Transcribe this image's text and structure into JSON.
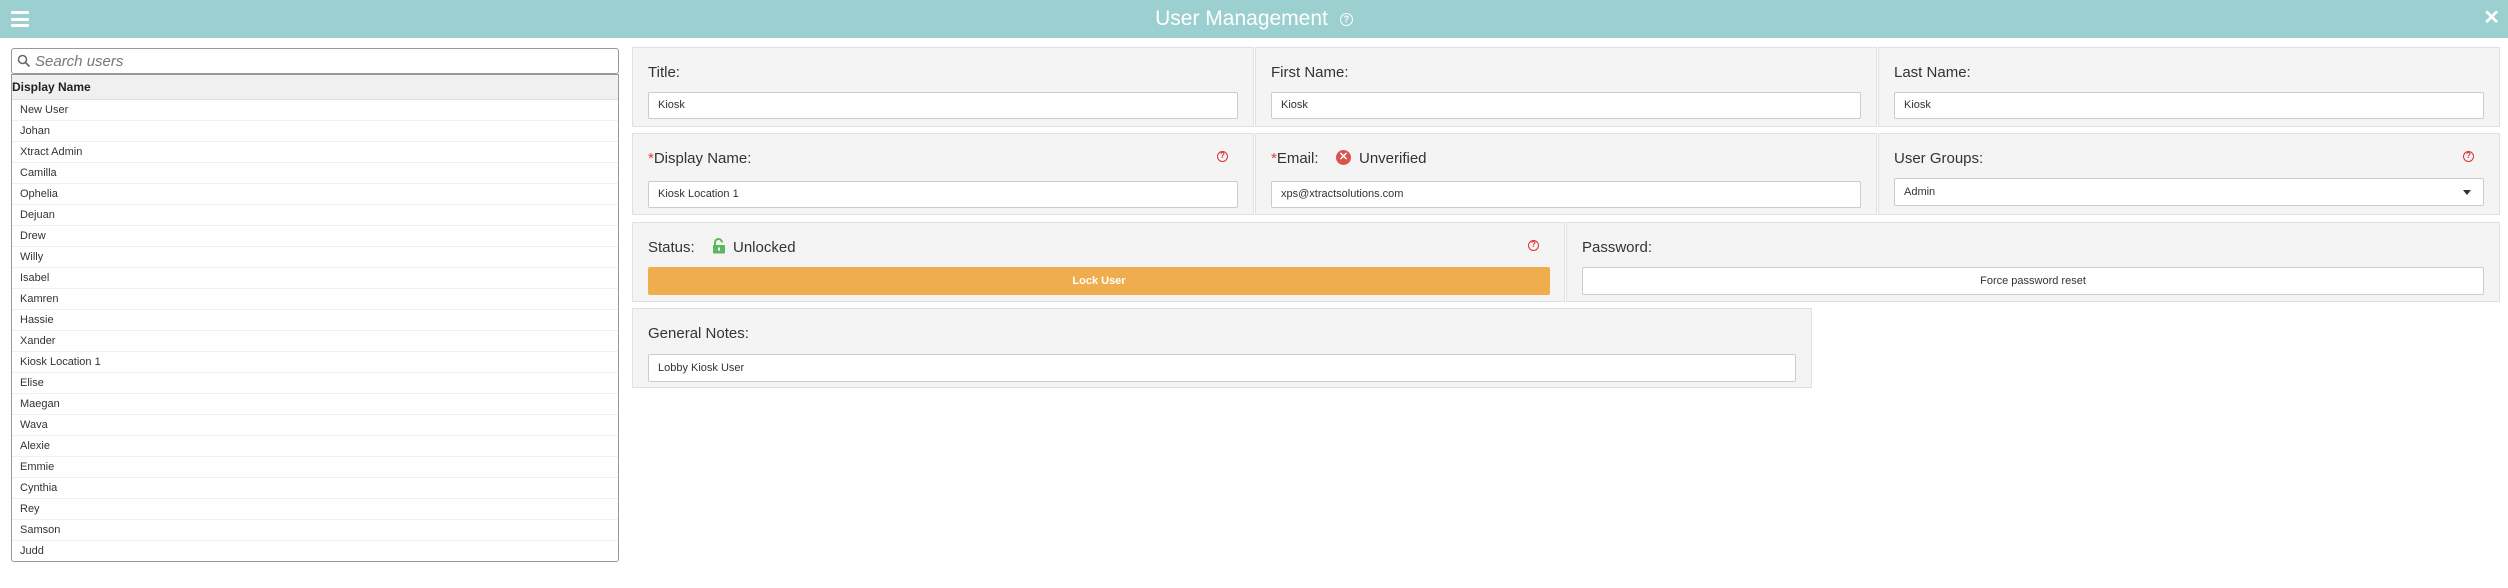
{
  "header": {
    "title": "User Management"
  },
  "search": {
    "placeholder": "Search users"
  },
  "list": {
    "column_header": "Display Name",
    "items": [
      "New User",
      "Johan",
      "Xtract Admin",
      "Camilla",
      "Ophelia",
      "Dejuan",
      "Drew",
      "Willy",
      "Isabel",
      "Kamren",
      "Hassie",
      "Xander",
      "Kiosk Location 1",
      "Elise",
      "Maegan",
      "Wava",
      "Alexie",
      "Emmie",
      "Cynthia",
      "Rey",
      "Samson",
      "Judd"
    ]
  },
  "form": {
    "title_label": "Title:",
    "title_value": "Kiosk",
    "first_name_label": "First Name:",
    "first_name_value": "Kiosk",
    "last_name_label": "Last Name:",
    "last_name_value": "Kiosk",
    "display_name_required": "*",
    "display_name_label": "Display Name:",
    "display_name_value": "Kiosk Location 1",
    "email_required": "*",
    "email_label": "Email:",
    "email_status": "Unverified",
    "email_value": "xps@xtractsolutions.com",
    "user_groups_label": "User Groups:",
    "user_groups_value": "Admin",
    "status_label": "Status:",
    "status_value": "Unlocked",
    "lock_button": "Lock User",
    "password_label": "Password:",
    "reset_button": "Force password reset",
    "notes_label": "General Notes:",
    "notes_value": "Lobby Kiosk User"
  },
  "colors": {
    "header": "#9ccfcf",
    "lock_button": "#f0ad4e",
    "error": "#d9534f",
    "unlocked": "#5cb85c"
  },
  "icons": {
    "menu": "hamburger-icon",
    "close": "close-icon",
    "help": "question-circle-icon",
    "search": "search-icon",
    "verify": "x-circle-icon",
    "lock": "unlock-icon"
  }
}
